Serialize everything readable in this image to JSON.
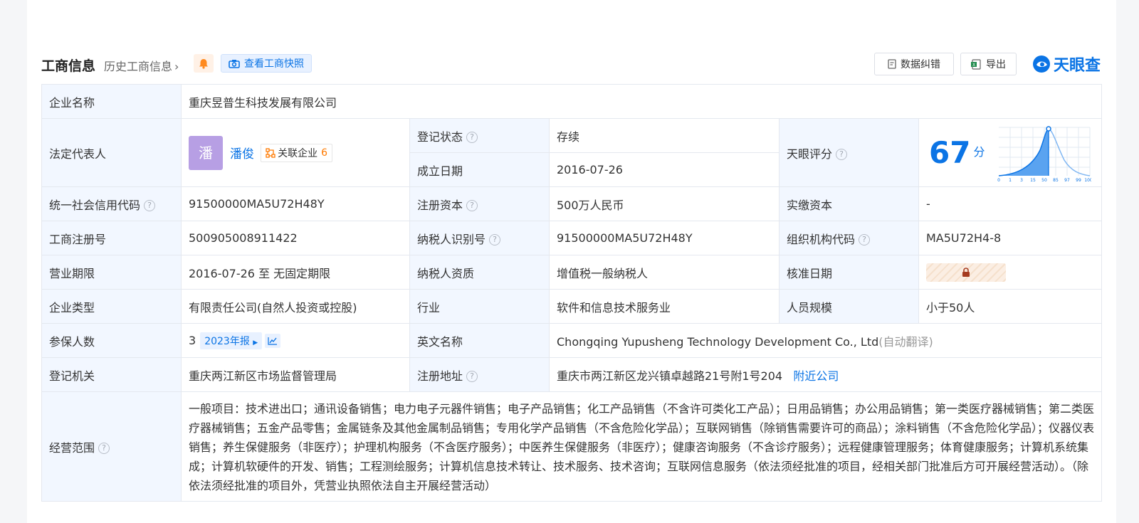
{
  "header": {
    "title": "工商信息",
    "history_link": "历史工商信息",
    "snapshot_btn": "查看工商快照",
    "correct_btn": "数据纠错",
    "export_btn": "导出",
    "logo_text": "天眼查"
  },
  "colors": {
    "accent": "#0b74e5",
    "label_bg": "#f2f7ff",
    "status_green": "#22a05b",
    "avatar": "#b79fe4"
  },
  "info": {
    "company_name_label": "企业名称",
    "company_name": "重庆昱普生科技发展有限公司",
    "legal_rep_label": "法定代表人",
    "legal_rep_avatar": "潘",
    "legal_rep_name": "潘俊",
    "related_label": "关联企业",
    "related_count": "6",
    "reg_status_label": "登记状态",
    "reg_status": "存续",
    "found_date_label": "成立日期",
    "found_date": "2016-07-26",
    "tianyan_score_label": "天眼评分",
    "score": "67",
    "score_unit": "分",
    "score_ticks": [
      "0",
      "1",
      "3",
      "15",
      "50",
      "85",
      "97",
      "99",
      "100"
    ],
    "credit_code_label": "统一社会信用代码",
    "credit_code": "91500000MA5U72H48Y",
    "reg_capital_label": "注册资本",
    "reg_capital": "500万人民币",
    "paid_capital_label": "实缴资本",
    "paid_capital": "-",
    "biz_reg_no_label": "工商注册号",
    "biz_reg_no": "500905008911422",
    "taxpayer_id_label": "纳税人识别号",
    "taxpayer_id": "91500000MA5U72H48Y",
    "org_code_label": "组织机构代码",
    "org_code": "MA5U72H4-8",
    "biz_term_label": "营业期限",
    "biz_term": "2016-07-26 至 无固定期限",
    "taxpayer_qual_label": "纳税人资质",
    "taxpayer_qual": "增值税一般纳税人",
    "approval_date_label": "核准日期",
    "company_type_label": "企业类型",
    "company_type": "有限责任公司(自然人投资或控股)",
    "industry_label": "行业",
    "industry": "软件和信息技术服务业",
    "staff_size_label": "人员规模",
    "staff_size": "小于50人",
    "insured_label": "参保人数",
    "insured": "3",
    "insured_year": "2023年报",
    "english_name_label": "英文名称",
    "english_name": "Chongqing Yupusheng Technology Development Co., Ltd",
    "auto_translate": "(自动翻译)",
    "reg_authority_label": "登记机关",
    "reg_authority": "重庆两江新区市场监督管理局",
    "reg_address_label": "注册地址",
    "reg_address": "重庆市两江新区龙兴镇卓越路21号附1号204",
    "nearby_link": "附近公司",
    "biz_scope_label": "经营范围",
    "biz_scope": "一般项目：技术进出口；通讯设备销售；电力电子元器件销售；电子产品销售；化工产品销售（不含许可类化工产品）；日用品销售；办公用品销售；第一类医疗器械销售；第二类医疗器械销售；五金产品零售；金属链条及其他金属制品销售；专用化学产品销售（不含危险化学品）；互联网销售（除销售需要许可的商品）；涂料销售（不含危险化学品）；仪器仪表销售；养生保健服务（非医疗）；护理机构服务（不含医疗服务）；中医养生保健服务（非医疗）；健康咨询服务（不含诊疗服务）；远程健康管理服务；体育健康服务；计算机系统集成；计算机软硬件的开发、销售；工程测绘服务；计算机信息技术转让、技术服务、技术咨询；互联网信息服务（依法须经批准的项目，经相关部门批准后方可开展经营活动）。（除依法须经批准的项目外，凭营业执照依法自主开展经营活动）"
  }
}
